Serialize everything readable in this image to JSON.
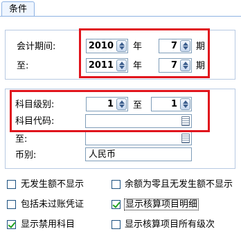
{
  "tab": {
    "label": "条件"
  },
  "period": {
    "from_label": "会计期间:",
    "to_label": "至:",
    "year_unit": "年",
    "period_unit": "期",
    "from_year": "2010",
    "from_period": "7",
    "to_year": "2011",
    "to_period": "7"
  },
  "subject": {
    "level_label": "科目级别:",
    "level_to": "至",
    "level_from_value": "1",
    "level_to_value": "1",
    "code_label": "科目代码:",
    "code_to_label": "至:",
    "code_from_value": "",
    "code_to_value": "",
    "currency_label": "币别:",
    "currency_value": "人民币"
  },
  "options": [
    {
      "label": "无发生额不显示",
      "checked": false
    },
    {
      "label": "余额为零且无发生额不显示",
      "checked": false
    },
    {
      "label": "包括未过账凭证",
      "checked": false
    },
    {
      "label": "显示核算项目明细",
      "checked": true
    },
    {
      "label": "显示禁用科目",
      "checked": true
    },
    {
      "label": "显示核算项目所有级次",
      "checked": false
    }
  ],
  "colors": {
    "highlight_border": "#e0141c",
    "panel_border": "#b7c9e2",
    "check_mark": "#21a121"
  }
}
